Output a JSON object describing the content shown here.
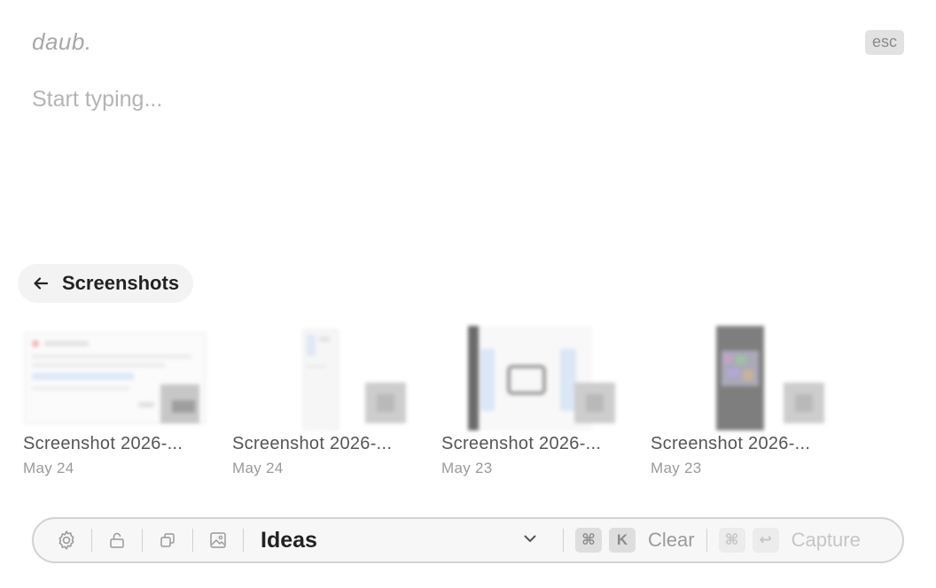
{
  "app": {
    "logo": "daub.",
    "esc_label": "esc"
  },
  "editor": {
    "placeholder": "Start typing..."
  },
  "back": {
    "label": "Screenshots"
  },
  "screenshots": [
    {
      "name": "Screenshot 2026-...",
      "date": "May 24"
    },
    {
      "name": "Screenshot 2026-...",
      "date": "May 24"
    },
    {
      "name": "Screenshot 2026-...",
      "date": "May 23"
    },
    {
      "name": "Screenshot 2026-...",
      "date": "May 23"
    }
  ],
  "toolbar": {
    "icons": [
      "gear-icon",
      "lock-icon",
      "copy-icon",
      "image-icon"
    ],
    "folder": "Ideas",
    "clear": {
      "keys": [
        "⌘",
        "K"
      ],
      "label": "Clear"
    },
    "capture": {
      "keys": [
        "⌘",
        "↩"
      ],
      "label": "Capture"
    }
  },
  "colors": {
    "background": "#ffffff",
    "muted": "#9b9b9b",
    "pill": "#f3f3f3"
  }
}
